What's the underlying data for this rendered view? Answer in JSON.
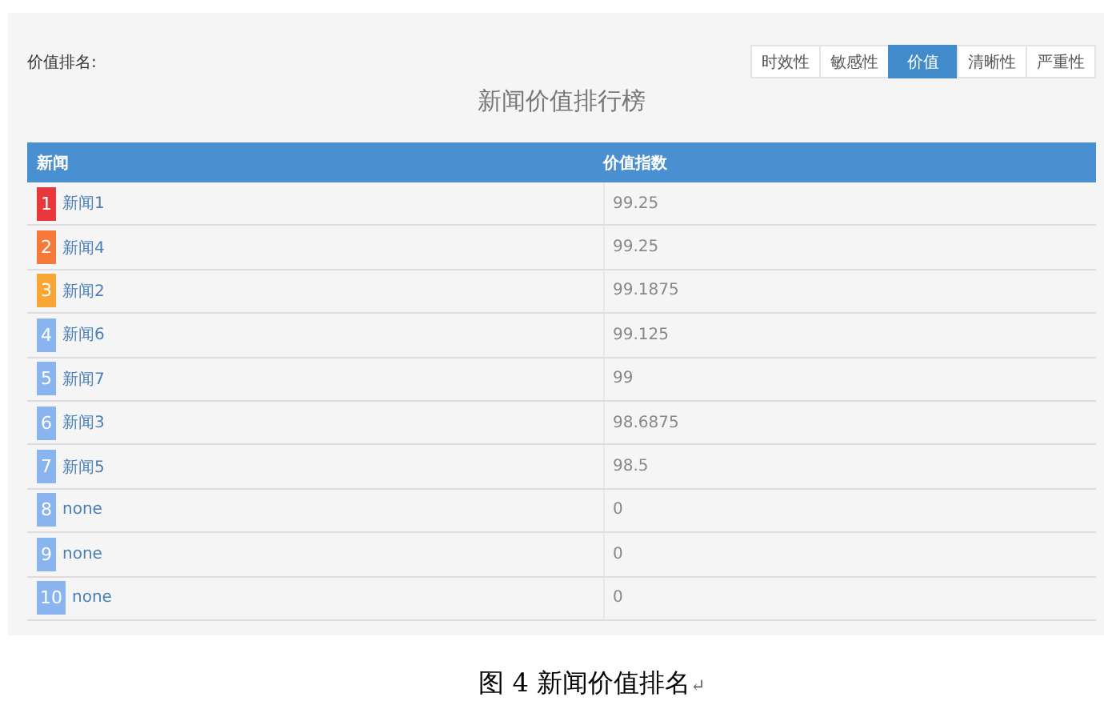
{
  "panel": {
    "label": "价值排名:",
    "title": "新闻价值排行榜",
    "tabs": [
      {
        "label": "时效性",
        "selected": false
      },
      {
        "label": "敏感性",
        "selected": false
      },
      {
        "label": "价值",
        "selected": true
      },
      {
        "label": "清晰性",
        "selected": false
      },
      {
        "label": "严重性",
        "selected": false
      }
    ],
    "table": {
      "columns": [
        "新闻",
        "价值指数"
      ],
      "rows": [
        {
          "rank": "1",
          "color": "#e8383d",
          "name": "新闻1",
          "score": "99.25"
        },
        {
          "rank": "2",
          "color": "#f7793a",
          "name": "新闻4",
          "score": "99.25"
        },
        {
          "rank": "3",
          "color": "#f9a636",
          "name": "新闻2",
          "score": "99.1875"
        },
        {
          "rank": "4",
          "color": "#8ab4f0",
          "name": "新闻6",
          "score": "99.125"
        },
        {
          "rank": "5",
          "color": "#8ab4f0",
          "name": "新闻7",
          "score": "99"
        },
        {
          "rank": "6",
          "color": "#8ab4f0",
          "name": "新闻3",
          "score": "98.6875"
        },
        {
          "rank": "7",
          "color": "#8ab4f0",
          "name": "新闻5",
          "score": "98.5"
        },
        {
          "rank": "8",
          "color": "#8ab4f0",
          "name": "none",
          "score": "0"
        },
        {
          "rank": "9",
          "color": "#8ab4f0",
          "name": "none",
          "score": "0"
        },
        {
          "rank": "10",
          "color": "#8ab4f0",
          "name": "none",
          "score": "0"
        }
      ]
    }
  },
  "caption": {
    "text": "图 4 新闻价值排名",
    "mark": "↵"
  }
}
